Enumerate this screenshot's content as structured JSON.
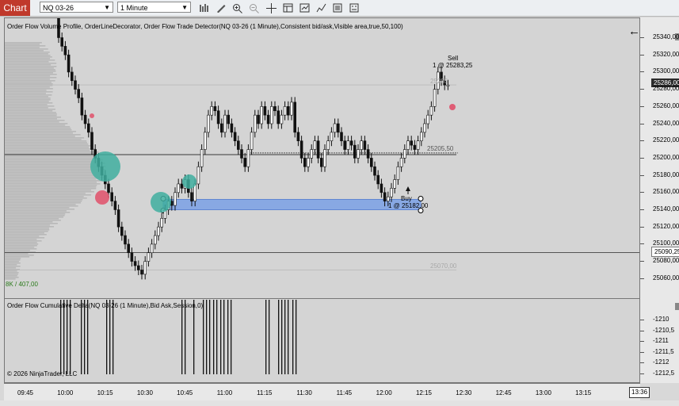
{
  "toolbar": {
    "chart_tab": "Chart",
    "instrument": "NQ 03-26",
    "interval": "1 Minute",
    "icons": [
      "bar-type-icon",
      "draw-tool-icon",
      "zoom-in-icon",
      "zoom-out-icon",
      "crosshair-icon",
      "data-box-icon",
      "strategies-icon",
      "indicators-icon",
      "chart-trader-icon",
      "properties-icon"
    ]
  },
  "price_panel": {
    "title": "Order Flow Volume Profile, OrderLineDecorator, Order Flow Trade Detector(NQ 03-26 (1 Minute),Consistent bid/ask,Visible area,true,50,100)",
    "volume_text": "8K / 407,00",
    "sell_label": "Sell",
    "sell_fill": "1 @ 25283,25",
    "buy_label": "Buy",
    "buy_fill": "1 @ 25182,00",
    "level_high": "25285",
    "level_mid": "25205,50",
    "level_low": "25070,00",
    "back_arrow": "←",
    "y_labels": [
      "25340,00",
      "25320,00",
      "25300,00",
      "25280,00",
      "25260,00",
      "25240,00",
      "25220,00",
      "25200,00",
      "25180,00",
      "25160,00",
      "25140,00",
      "25120,00",
      "25100,00",
      "25080,00",
      "25060,00"
    ],
    "last_price_tag": "25286,00",
    "line_tag": "25090,25"
  },
  "delta_panel": {
    "title": "Order Flow Cumulative Delta(NQ 03-26 (1 Minute),Bid Ask,Session,0)",
    "copyright": "© 2026 NinjaTrader, LLC",
    "y_labels": [
      "-1210",
      "-1210,5",
      "-1211",
      "-1211,5",
      "-1212",
      "-1212,5"
    ]
  },
  "x_axis": {
    "labels": [
      "09:45",
      "10:00",
      "10:15",
      "10:30",
      "10:45",
      "11:00",
      "11:15",
      "11:30",
      "11:45",
      "12:00",
      "12:15",
      "12:30",
      "12:45",
      "13:00",
      "13:15"
    ],
    "current_time": "13:36"
  },
  "colors": {
    "buy_zone": "#6f9ae8",
    "bubble_teal": "#3fae9f",
    "bubble_red": "#e0506a",
    "chart_tab": "#c0392b",
    "panel_bg": "#d4d4d4",
    "profile_gray": "#b8b8b8"
  }
}
